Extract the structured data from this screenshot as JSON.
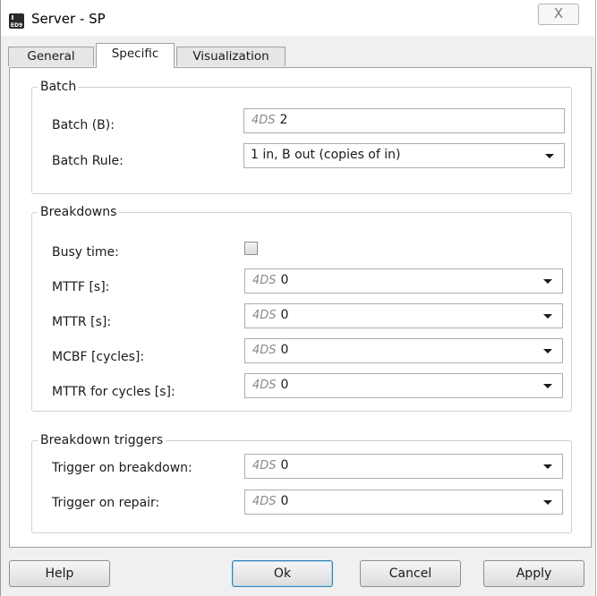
{
  "window": {
    "title": "Server - SP",
    "app_icon_text": "ED9",
    "close_label": "X"
  },
  "tabs": [
    {
      "label": "General",
      "active": false
    },
    {
      "label": "Specific",
      "active": true
    },
    {
      "label": "Visualization",
      "active": false
    }
  ],
  "batch": {
    "group_title": "Batch",
    "batch_label": "Batch (B):",
    "batch_prefix": "4DS",
    "batch_value": "2",
    "rule_label": "Batch Rule:",
    "rule_value": "1 in, B out (copies of in)"
  },
  "breakdowns": {
    "group_title": "Breakdowns",
    "busy_time_label": "Busy time:",
    "busy_time_checked": false,
    "rows": [
      {
        "label": "MTTF [s]:",
        "prefix": "4DS",
        "value": "0"
      },
      {
        "label": "MTTR [s]:",
        "prefix": "4DS",
        "value": "0"
      },
      {
        "label": "MCBF [cycles]:",
        "prefix": "4DS",
        "value": "0"
      },
      {
        "label": "MTTR for cycles [s]:",
        "prefix": "4DS",
        "value": "0"
      }
    ]
  },
  "triggers": {
    "group_title": "Breakdown triggers",
    "rows": [
      {
        "label": "Trigger on breakdown:",
        "prefix": "4DS",
        "value": "0"
      },
      {
        "label": "Trigger on repair:",
        "prefix": "4DS",
        "value": "0"
      }
    ]
  },
  "buttons": {
    "help": "Help",
    "ok": "Ok",
    "cancel": "Cancel",
    "apply": "Apply"
  },
  "colors": {
    "window_bg": "#f0f0f0",
    "panel_bg": "#ffffff",
    "default_button_border": "#3c7fb1"
  },
  "icons": {
    "app": "ed9-app-icon",
    "close": "close-icon",
    "dropdown": "chevron-down-icon"
  }
}
